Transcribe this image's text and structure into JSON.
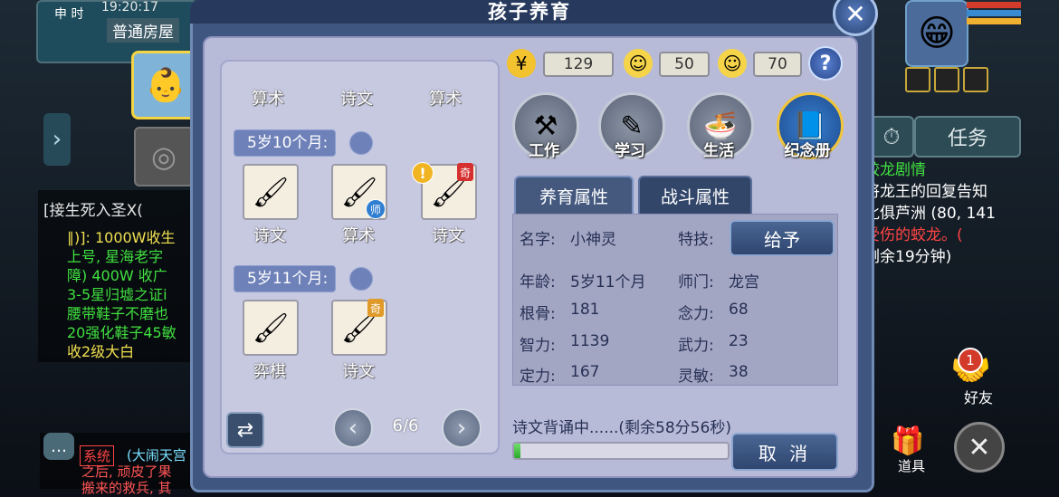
{
  "hud": {
    "time_label": "申 时",
    "clock": "19:20:17",
    "room": "普通房屋",
    "chat_title": "[接生死入圣X(",
    "chat_lines": [
      {
        "text": "∥)]: 1000W收生",
        "color": "#f0e050"
      },
      {
        "text": "上号, 星海老字",
        "color": "#40e040"
      },
      {
        "text": "障) 400W 收广",
        "color": "#40e040"
      },
      {
        "text": "3-5星归墟之证i",
        "color": "#40e040"
      },
      {
        "text": "腰带鞋子不磨也",
        "color": "#40e040"
      },
      {
        "text": "20强化鞋子45敏",
        "color": "#40e040"
      },
      {
        "text": "收2级大白",
        "color": "#f0e050"
      }
    ],
    "sys_tag": "系统",
    "sys_text": "(大闹天宫",
    "sys_line2": "之后, 顽皮了果",
    "sys_line3": "搬来的救兵, 其",
    "quest_button": "任务",
    "quest_lines": [
      {
        "text": "蛟龙剧情",
        "color": "#40e040"
      },
      {
        "text": "将龙王的回复告知",
        "color": "#ffffff"
      },
      {
        "text": "牝俱芦洲 (80, 141",
        "color": "#ffffff"
      },
      {
        "text": "受伤的蛟龙。(",
        "color": "#ff4444"
      },
      {
        "text": "剩余19分钟)",
        "color": "#ffffff"
      }
    ],
    "friend_badge": "1",
    "friend_label": "好友",
    "bag_label": "道具",
    "hp_colors": [
      "#d23a2a",
      "#3a8ad2",
      "#f0b030"
    ]
  },
  "dialog": {
    "title": "孩子养育",
    "subjects_top": [
      "算术",
      "诗文",
      "算术"
    ],
    "age1": "5岁10个月:",
    "age1_items": [
      {
        "label": "诗文",
        "icon": "brush-icon"
      },
      {
        "label": "算术",
        "icon": "brush-icon",
        "badge": "师"
      },
      {
        "label": "诗文",
        "icon": "brush-icon",
        "badge": "奇",
        "warning": "!"
      }
    ],
    "age2": "5岁11个月:",
    "age2_items": [
      {
        "label": "弈棋",
        "icon": "brush-icon"
      },
      {
        "label": "诗文",
        "icon": "brush-icon",
        "badge": "奇"
      }
    ],
    "page": "6/6",
    "stats": [
      {
        "icon": "coin-icon",
        "value": "129",
        "color": "#f3c22f"
      },
      {
        "icon": "happy-face-icon",
        "value": "50",
        "color": "#f5d44a"
      },
      {
        "icon": "calm-face-icon",
        "value": "70",
        "color": "#f5d44a"
      }
    ],
    "help": "?",
    "actions": [
      "工作",
      "学习",
      "生活",
      "纪念册"
    ],
    "tabs": [
      "养育属性",
      "战斗属性"
    ],
    "attrs": {
      "name_label": "名字:",
      "name_value": "小神灵",
      "skill_label": "特技:",
      "give_button": "给予",
      "age_label": "年龄:",
      "age_value": "5岁11个月",
      "school_label": "师门:",
      "school_value": "龙宫",
      "gengu_label": "根骨:",
      "gengu_value": "181",
      "nianli_label": "念力:",
      "nianli_value": "68",
      "zhili_label": "智力:",
      "zhili_value": "1139",
      "wuli_label": "武力:",
      "wuli_value": "23",
      "dingli_label": "定力:",
      "dingli_value": "167",
      "lingmin_label": "灵敏:",
      "lingmin_value": "38"
    },
    "status": "诗文背诵中......(剩余58分56秒)",
    "progress_fraction": 0.03,
    "cancel_button": "取 消"
  }
}
